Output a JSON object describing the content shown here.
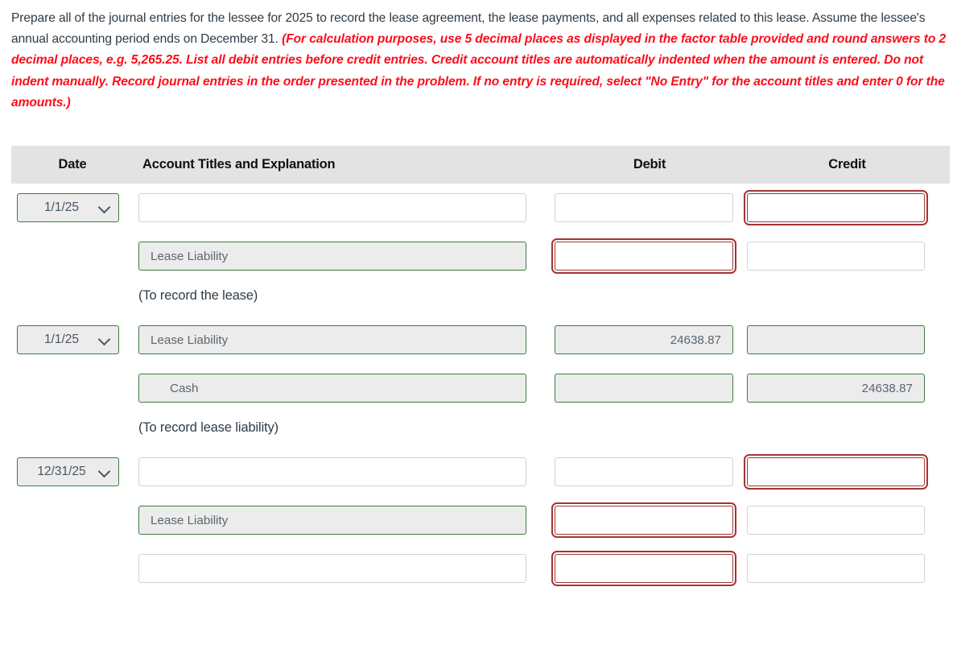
{
  "instructions": {
    "plain_1": "Prepare all of the journal entries for the lessee for 2025 to record the lease agreement, the lease payments, and all expenses related to this lease. Assume the lessee's annual accounting period ends on December 31. ",
    "emphasis": "(For calculation purposes, use 5 decimal places as displayed in the factor table provided and round answers to 2 decimal places, e.g. 5,265.25. List all debit entries before credit entries. Credit account titles are automatically indented when the amount is entered. Do not indent manually. Record journal entries in the order presented in the problem. If no entry is required, select \"No Entry\" for the account titles and enter 0 for the amounts.)"
  },
  "table": {
    "headers": {
      "date": "Date",
      "account": "Account Titles and Explanation",
      "debit": "Debit",
      "credit": "Credit"
    },
    "colors": {
      "header_bg": "#e3e3e3",
      "filled_border": "#3c7d3c",
      "filled_bg": "#ececec",
      "error_border": "#a03634",
      "empty_border": "#d2d2d2",
      "emphasis_text": "#fc0d1b",
      "body_text": "#2f3b45"
    },
    "rows": [
      {
        "type": "entry",
        "date": "1/1/25",
        "date_state": "filled",
        "account": "",
        "account_state": "empty",
        "account_indent": false,
        "debit": "",
        "debit_state": "empty",
        "credit": "",
        "credit_state": "error"
      },
      {
        "type": "entry",
        "date": "",
        "date_state": "none",
        "account": "Lease Liability",
        "account_state": "filled",
        "account_indent": false,
        "debit": "",
        "debit_state": "error",
        "credit": "",
        "credit_state": "empty"
      },
      {
        "type": "explanation",
        "text": "(To record the lease)"
      },
      {
        "type": "entry",
        "date": "1/1/25",
        "date_state": "filled",
        "account": "Lease Liability",
        "account_state": "filled",
        "account_indent": false,
        "debit": "24638.87",
        "debit_state": "filled",
        "credit": "",
        "credit_state": "filled"
      },
      {
        "type": "entry",
        "date": "",
        "date_state": "none",
        "account": "Cash",
        "account_state": "filled",
        "account_indent": true,
        "debit": "",
        "debit_state": "filled",
        "credit": "24638.87",
        "credit_state": "filled"
      },
      {
        "type": "explanation",
        "text": "(To record lease liability)"
      },
      {
        "type": "entry",
        "date": "12/31/25",
        "date_state": "filled",
        "account": "",
        "account_state": "empty",
        "account_indent": false,
        "debit": "",
        "debit_state": "empty",
        "credit": "",
        "credit_state": "error"
      },
      {
        "type": "entry",
        "date": "",
        "date_state": "none",
        "account": "Lease Liability",
        "account_state": "filled",
        "account_indent": false,
        "debit": "",
        "debit_state": "error",
        "credit": "",
        "credit_state": "empty"
      },
      {
        "type": "entry",
        "date": "",
        "date_state": "none",
        "account": "",
        "account_state": "empty",
        "account_indent": false,
        "debit": "",
        "debit_state": "error",
        "credit": "",
        "credit_state": "empty"
      }
    ]
  }
}
